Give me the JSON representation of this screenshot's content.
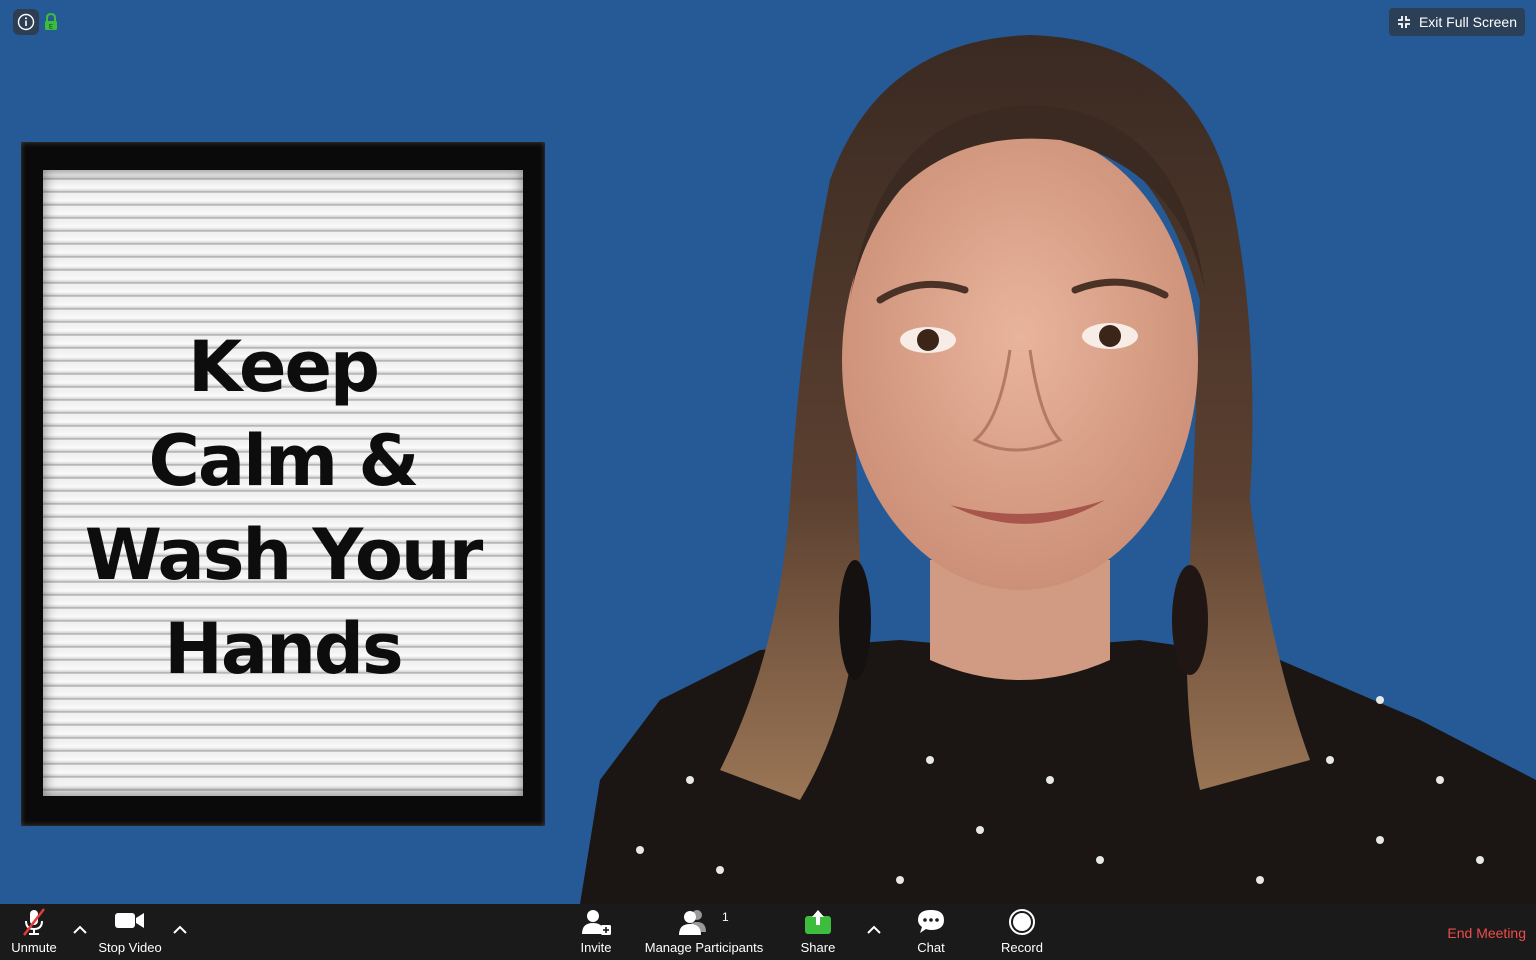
{
  "top_bar": {
    "exit_full_screen_label": "Exit Full Screen",
    "info_icon": "info-icon",
    "lock_icon": "lock-icon"
  },
  "letter_board": {
    "lines": [
      "Keep",
      "Calm &",
      "Wash Your",
      "Hands"
    ]
  },
  "toolbar": {
    "unmute_label": "Unmute",
    "stop_video_label": "Stop Video",
    "invite_label": "Invite",
    "manage_participants_label": "Manage Participants",
    "participant_count": "1",
    "share_label": "Share",
    "chat_label": "Chat",
    "record_label": "Record",
    "end_meeting_label": "End Meeting"
  },
  "colors": {
    "background_blue": "#255a97",
    "toolbar_bg": "#1a1a1a",
    "end_meeting_red": "#f04b4b",
    "share_green": "#3dbd3d",
    "mute_slash_red": "#e23c3c"
  }
}
